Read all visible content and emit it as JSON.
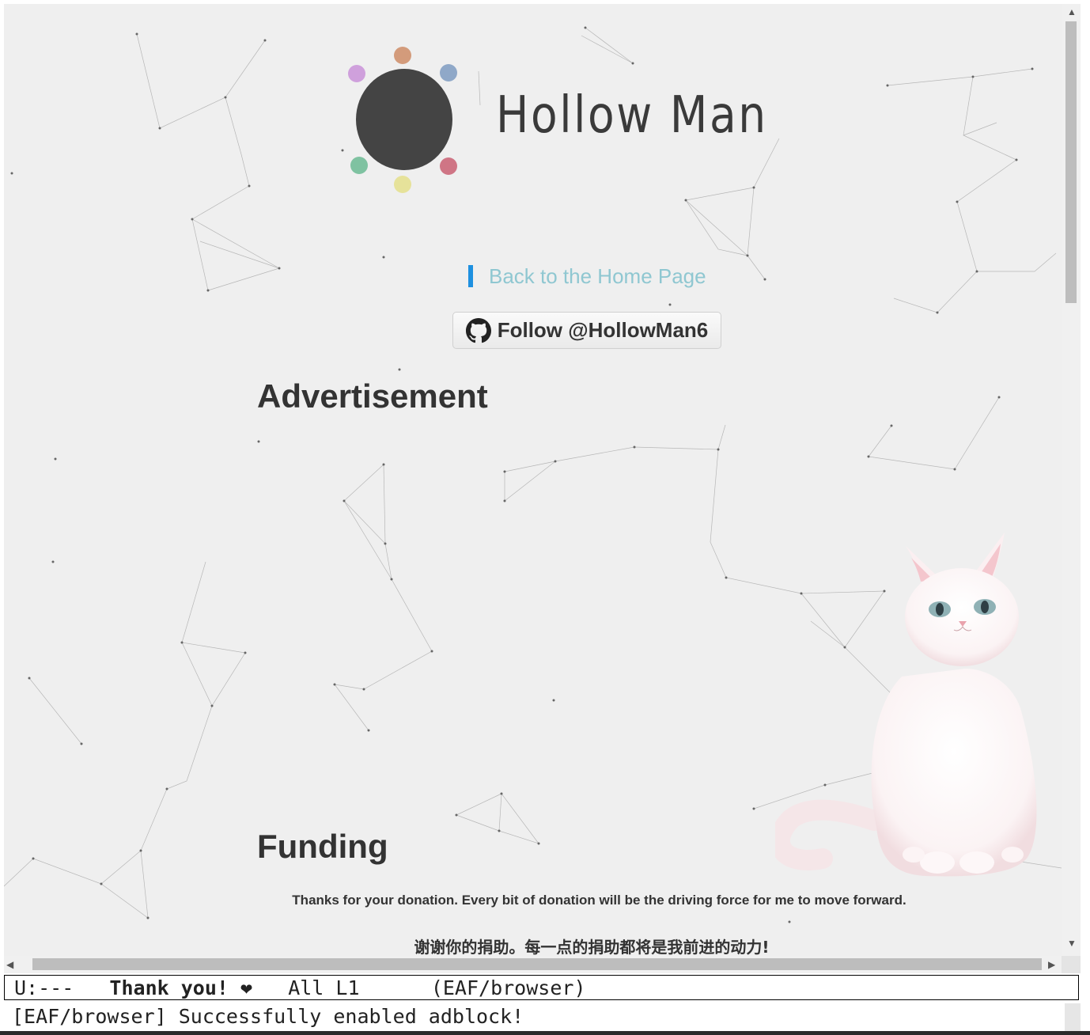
{
  "header": {
    "brand_name": "Hollow Man",
    "logo_dot_colors": [
      "#d39b7b",
      "#8fa8c8",
      "#cf7585",
      "#e6e29a",
      "#7fc2a1",
      "#cfa0dc"
    ]
  },
  "nav": {
    "back_link": "Back to the Home Page",
    "follow_button": "Follow @HollowMan6"
  },
  "sections": {
    "advertisement_heading": "Advertisement",
    "funding_heading": "Funding",
    "funding_text_en": "Thanks for your donation. Every bit of donation will be the driving force for me to move forward.",
    "funding_text_zh": "谢谢你的捐助。每一点的捐助都将是我前进的动力!"
  },
  "modeline": {
    "status": "U:---",
    "buffer_name": "Thank you! ❤",
    "position": "All L1",
    "mode": "(EAF/browser)"
  },
  "minibuffer": {
    "message": "[EAF/browser] Successfully enabled adblock!"
  },
  "icons": [
    "github-icon",
    "cat-illustration",
    "scroll-up-arrow-icon",
    "scroll-down-arrow-icon",
    "scroll-left-arrow-icon",
    "scroll-right-arrow-icon"
  ]
}
